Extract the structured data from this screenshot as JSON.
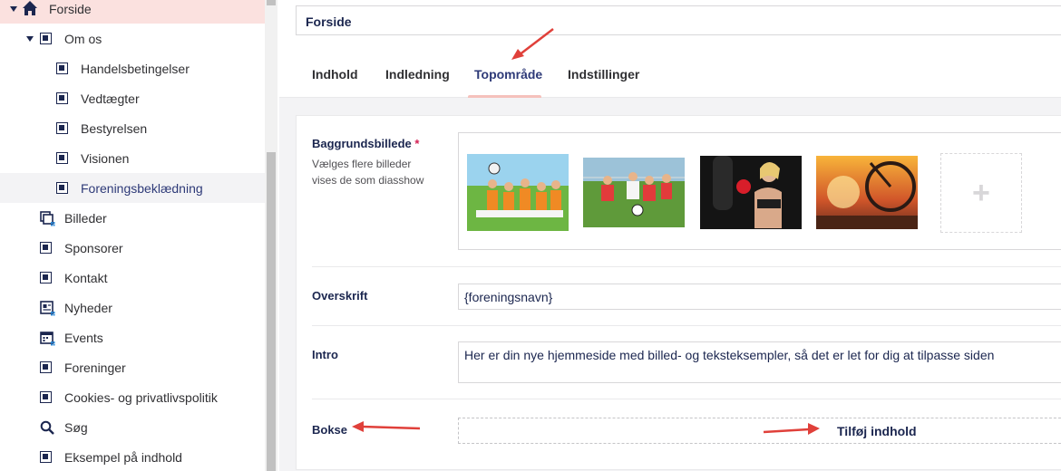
{
  "sidebar": {
    "items": [
      {
        "label": "Forside",
        "icon": "home-icon"
      },
      {
        "label": "Om os",
        "icon": "document-icon"
      },
      {
        "label": "Handelsbetingelser",
        "icon": "document-icon"
      },
      {
        "label": "Vedtægter",
        "icon": "document-icon"
      },
      {
        "label": "Bestyrelsen",
        "icon": "document-icon"
      },
      {
        "label": "Visionen",
        "icon": "document-icon"
      },
      {
        "label": "Foreningsbeklædning",
        "icon": "document-icon"
      },
      {
        "label": "Billeder",
        "icon": "gallery-icon"
      },
      {
        "label": "Sponsorer",
        "icon": "document-icon"
      },
      {
        "label": "Kontakt",
        "icon": "document-icon"
      },
      {
        "label": "Nyheder",
        "icon": "news-icon"
      },
      {
        "label": "Events",
        "icon": "calendar-icon"
      },
      {
        "label": "Foreninger",
        "icon": "document-icon"
      },
      {
        "label": "Cookies- og privatlivspolitik",
        "icon": "document-icon"
      },
      {
        "label": "Søg",
        "icon": "search-icon"
      },
      {
        "label": "Eksempel på indhold",
        "icon": "document-icon"
      }
    ]
  },
  "editor": {
    "node_name": "Forside",
    "tabs": [
      {
        "label": "Indhold"
      },
      {
        "label": "Indledning"
      },
      {
        "label": "Topområde"
      },
      {
        "label": "Indstillinger"
      }
    ],
    "active_tab": "Topområde",
    "properties": {
      "background": {
        "label": "Baggrundsbillede",
        "required_mark": "*",
        "description": "Vælges flere billeder vises de som diasshow",
        "images": [
          "image-kids-football-team",
          "image-kids-football-match",
          "image-woman-boxing",
          "image-cyclist-sunset"
        ],
        "add_symbol": "+"
      },
      "headline": {
        "label": "Overskrift",
        "value": "{foreningsnavn}"
      },
      "intro": {
        "label": "Intro",
        "value": "Her er din nye hjemmeside med billed- og teksteksempler, så det er let for dig at tilpasse siden"
      },
      "boxes": {
        "label": "Bokse",
        "add_content_label": "Tilføj indhold"
      }
    }
  },
  "colors": {
    "accent": "#2e3a78",
    "root_highlight": "#fbe1df",
    "annotation_arrow": "#e0403a",
    "required": "#d42054"
  }
}
